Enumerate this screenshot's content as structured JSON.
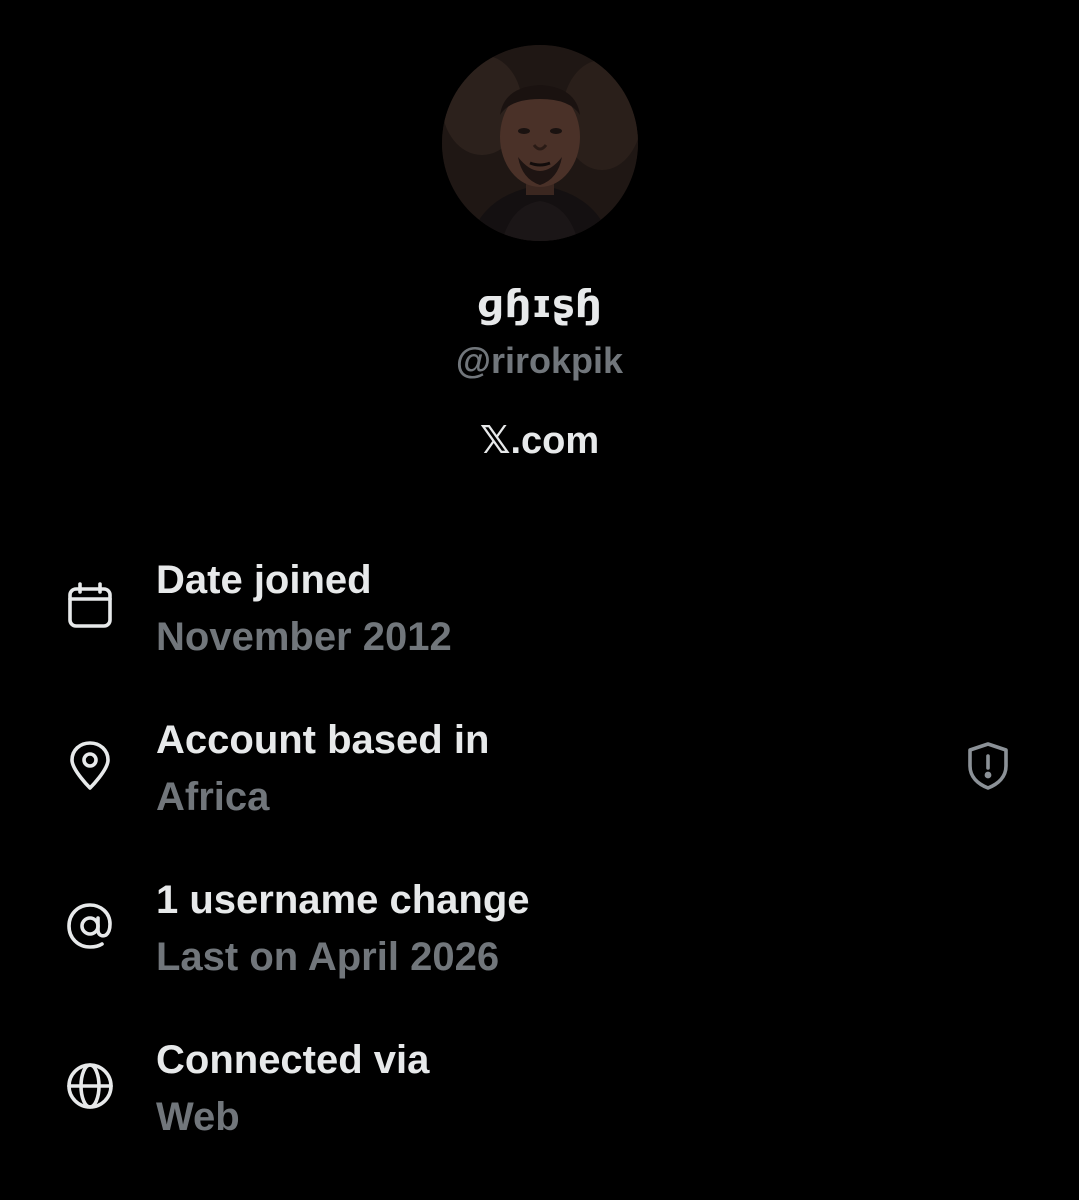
{
  "profile": {
    "display_name": "ɡɧɪʂɧ",
    "handle": "@rirokpik",
    "platform_glyph": "𝕏",
    "platform_suffix": ".com"
  },
  "info": [
    {
      "icon": "calendar-icon",
      "title": "Date joined",
      "value": "November 2012"
    },
    {
      "icon": "location-pin-icon",
      "title": "Account based in",
      "value": "Africa"
    },
    {
      "icon": "at-sign-icon",
      "title": "1 username change",
      "value": "Last on April 2026"
    },
    {
      "icon": "globe-icon",
      "title": "Connected via",
      "value": "Web"
    }
  ],
  "colors": {
    "background": "#000000",
    "primary_text": "#e7e9ea",
    "secondary_text": "#71767b"
  },
  "shield_icon": "shield-alert-icon"
}
